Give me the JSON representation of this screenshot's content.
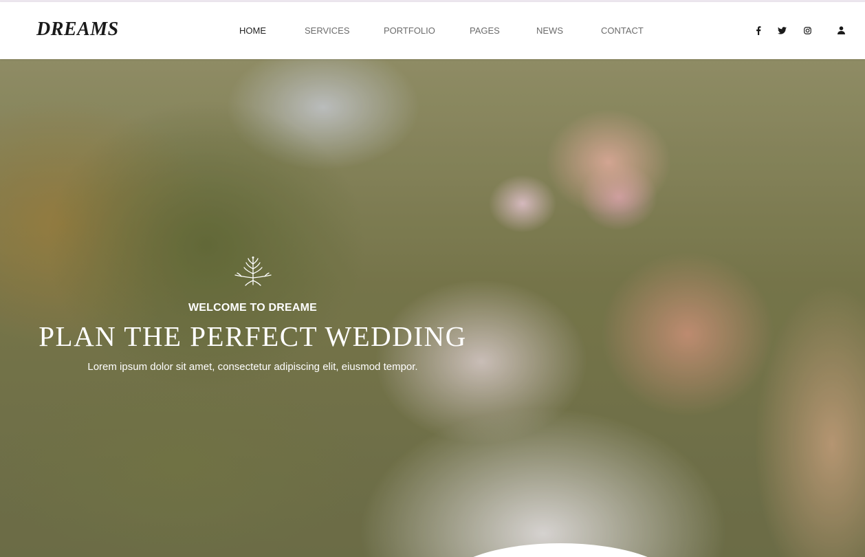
{
  "brand": {
    "logo": "DREAMS"
  },
  "nav": {
    "items": [
      {
        "label": "HOME",
        "active": true
      },
      {
        "label": "SERVICES",
        "active": false
      },
      {
        "label": "PORTFOLIO",
        "active": false
      },
      {
        "label": "PAGES",
        "active": false
      },
      {
        "label": "NEWS",
        "active": false
      },
      {
        "label": "CONTACT",
        "active": false
      }
    ]
  },
  "social": {
    "icons": [
      "facebook-icon",
      "twitter-icon",
      "instagram-icon",
      "user-icon"
    ]
  },
  "hero": {
    "ornament_icon": "leaf-sprig-icon",
    "kicker": "WELCOME TO DREAME",
    "title": "PLAN THE PERFECT WEDDING",
    "subtitle": "Lorem ipsum dolor sit amet, consectetur adipiscing elit, eiusmod tempor."
  },
  "colors": {
    "nav_active": "#222222",
    "nav_text": "#6b6b6b",
    "hero_text": "#ffffff"
  }
}
